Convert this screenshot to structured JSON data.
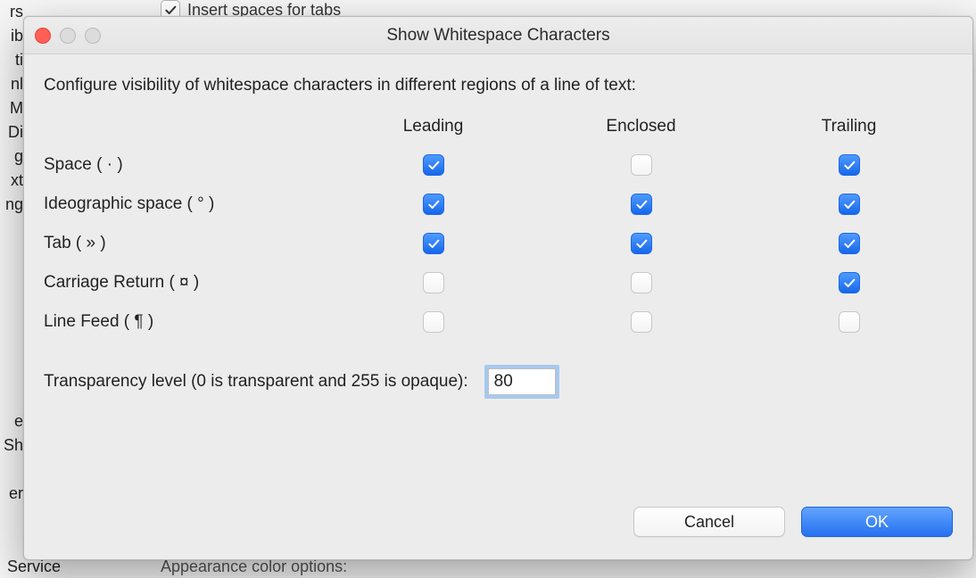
{
  "background": {
    "insert_spaces_label": "Insert spaces for tabs",
    "insert_spaces_checked": true,
    "left_strip_text": "rs\nib\nti\nnl\nM\nDi\ng\nxt\nng\n\n\n\n\n\n\n\n\ne\nSh\n\ner",
    "bottom_left": "Service",
    "bottom_mid": "Appearance color options:"
  },
  "dialog": {
    "title": "Show Whitespace Characters",
    "description": "Configure visibility of whitespace characters in different regions of a line of text:",
    "columns": [
      "Leading",
      "Enclosed",
      "Trailing"
    ],
    "rows": [
      {
        "label": "Space ( · )",
        "leading": true,
        "enclosed": false,
        "trailing": true
      },
      {
        "label": "Ideographic space ( ° )",
        "leading": true,
        "enclosed": true,
        "trailing": true
      },
      {
        "label": "Tab ( » )",
        "leading": true,
        "enclosed": true,
        "trailing": true
      },
      {
        "label": "Carriage Return ( ¤ )",
        "leading": false,
        "enclosed": false,
        "trailing": true
      },
      {
        "label": "Line Feed ( ¶ )",
        "leading": false,
        "enclosed": false,
        "trailing": false
      }
    ],
    "transparency_label": "Transparency level (0 is transparent and 255 is opaque):",
    "transparency_value": "80",
    "buttons": {
      "cancel": "Cancel",
      "ok": "OK"
    }
  }
}
